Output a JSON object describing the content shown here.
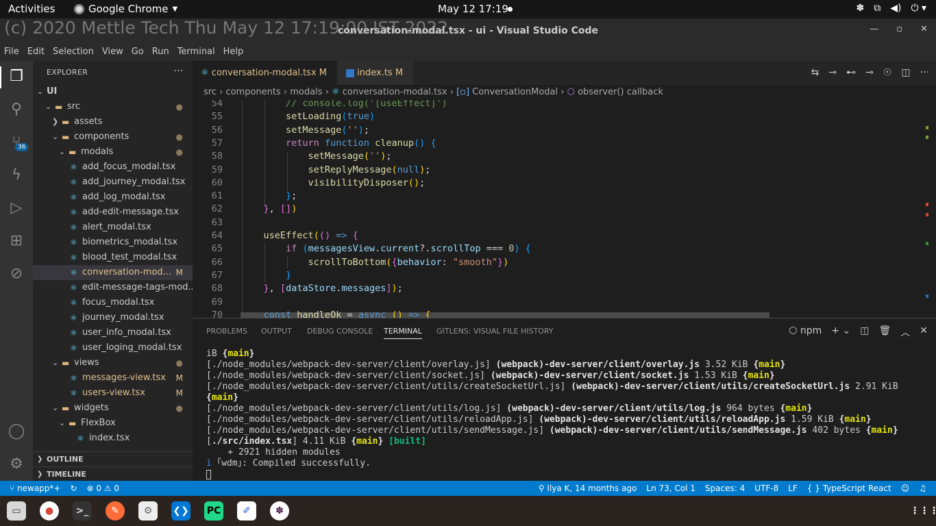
{
  "topbar": {
    "activities": "Activities",
    "app": "Google Chrome",
    "clock": "May 12  17:19"
  },
  "window": {
    "title": "conversation-modal.tsx - ui - Visual Studio Code",
    "watermark": "(c) 2020 Mettle Tech Thu May 12 17:19:00 IST 2022"
  },
  "menu": [
    "File",
    "Edit",
    "Selection",
    "View",
    "Go",
    "Run",
    "Terminal",
    "Help"
  ],
  "activity": {
    "scm_badge": "36"
  },
  "sidebar": {
    "header": "EXPLORER",
    "tree": [
      {
        "label": "UI",
        "depth": 0,
        "kind": "root",
        "open": true,
        "status": ""
      },
      {
        "label": "src",
        "depth": 1,
        "kind": "folder",
        "open": true,
        "status": "●"
      },
      {
        "label": "assets",
        "depth": 2,
        "kind": "folder",
        "open": false,
        "status": ""
      },
      {
        "label": "components",
        "depth": 2,
        "kind": "folder",
        "open": true,
        "status": "●"
      },
      {
        "label": "modals",
        "depth": 3,
        "kind": "folder",
        "open": true,
        "status": "●"
      },
      {
        "label": "add_focus_modal.tsx",
        "depth": 4,
        "kind": "file",
        "status": ""
      },
      {
        "label": "add_journey_modal.tsx",
        "depth": 4,
        "kind": "file",
        "status": ""
      },
      {
        "label": "add_log_modal.tsx",
        "depth": 4,
        "kind": "file",
        "status": ""
      },
      {
        "label": "add-edit-message.tsx",
        "depth": 4,
        "kind": "file",
        "status": ""
      },
      {
        "label": "alert_modal.tsx",
        "depth": 4,
        "kind": "file",
        "status": ""
      },
      {
        "label": "biometrics_modal.tsx",
        "depth": 4,
        "kind": "file",
        "status": ""
      },
      {
        "label": "blood_test_modal.tsx",
        "depth": 4,
        "kind": "file",
        "status": ""
      },
      {
        "label": "conversation-mod...",
        "depth": 4,
        "kind": "file",
        "status": "M",
        "selected": true
      },
      {
        "label": "edit-message-tags-mod...",
        "depth": 4,
        "kind": "file",
        "status": ""
      },
      {
        "label": "focus_modal.tsx",
        "depth": 4,
        "kind": "file",
        "status": ""
      },
      {
        "label": "journey_modal.tsx",
        "depth": 4,
        "kind": "file",
        "status": ""
      },
      {
        "label": "user_info_modal.tsx",
        "depth": 4,
        "kind": "file",
        "status": ""
      },
      {
        "label": "user_loging_modal.tsx",
        "depth": 4,
        "kind": "file",
        "status": ""
      },
      {
        "label": "views",
        "depth": 2,
        "kind": "folder",
        "open": true,
        "status": "●"
      },
      {
        "label": "messages-view.tsx",
        "depth": 4,
        "kind": "file",
        "status": "M"
      },
      {
        "label": "users-view.tsx",
        "depth": 4,
        "kind": "file",
        "status": "M"
      },
      {
        "label": "widgets",
        "depth": 2,
        "kind": "folder",
        "open": true,
        "status": "●"
      },
      {
        "label": "FlexBox",
        "depth": 3,
        "kind": "folder",
        "open": true,
        "status": ""
      },
      {
        "label": "index.tsx",
        "depth": 5,
        "kind": "file",
        "status": ""
      }
    ],
    "outline": "OUTLINE",
    "timeline": "TIMELINE"
  },
  "tabs": [
    {
      "label": "conversation-modal.tsx",
      "badge": "M",
      "active": true,
      "close": "✕"
    },
    {
      "label": "index.ts",
      "badge": "M",
      "active": false
    }
  ],
  "breadcrumb": [
    "src",
    "components",
    "modals",
    "conversation-modal.tsx",
    "ConversationModal",
    "observer() callback"
  ],
  "code": [
    {
      "n": "54",
      "t": [
        [
          "cm",
          "        // console.log('[useEffect]')"
        ]
      ]
    },
    {
      "n": "55",
      "t": [
        [
          "",
          "        "
        ],
        [
          "fn",
          "setLoading"
        ],
        [
          "p3",
          "("
        ],
        [
          "kw",
          "true"
        ],
        [
          "p3",
          ")"
        ]
      ]
    },
    {
      "n": "56",
      "t": [
        [
          "",
          "        "
        ],
        [
          "fn",
          "setMessage"
        ],
        [
          "p3",
          "("
        ],
        [
          "st",
          "''"
        ],
        [
          "p3",
          ")"
        ],
        [
          "",
          ";"
        ]
      ]
    },
    {
      "n": "57",
      "t": [
        [
          "",
          "        "
        ],
        [
          "ctl",
          "return"
        ],
        [
          "",
          " "
        ],
        [
          "kw",
          "function"
        ],
        [
          "",
          " "
        ],
        [
          "fn",
          "cleanup"
        ],
        [
          "p3",
          "()"
        ],
        [
          "",
          " "
        ],
        [
          "p3",
          "{"
        ]
      ]
    },
    {
      "n": "58",
      "t": [
        [
          "",
          "            "
        ],
        [
          "fn",
          "setMessage"
        ],
        [
          "p1",
          "("
        ],
        [
          "st",
          "''"
        ],
        [
          "p1",
          ")"
        ],
        [
          "",
          ";"
        ]
      ]
    },
    {
      "n": "59",
      "t": [
        [
          "",
          "            "
        ],
        [
          "fn",
          "setReplyMessage"
        ],
        [
          "p1",
          "("
        ],
        [
          "kw",
          "null"
        ],
        [
          "p1",
          ")"
        ],
        [
          "",
          ";"
        ]
      ]
    },
    {
      "n": "60",
      "t": [
        [
          "",
          "            "
        ],
        [
          "fn",
          "visibilityDisposer"
        ],
        [
          "p1",
          "()"
        ],
        [
          "",
          ";"
        ]
      ]
    },
    {
      "n": "61",
      "t": [
        [
          "",
          "        "
        ],
        [
          "p3",
          "}"
        ],
        [
          "",
          ";"
        ]
      ]
    },
    {
      "n": "62",
      "t": [
        [
          "",
          "    "
        ],
        [
          "p2",
          "}"
        ],
        [
          "",
          ", "
        ],
        [
          "p2",
          "[]"
        ],
        [
          "p1",
          ")"
        ]
      ]
    },
    {
      "n": "63",
      "t": [
        [
          "",
          ""
        ]
      ]
    },
    {
      "n": "64",
      "t": [
        [
          "",
          "    "
        ],
        [
          "fn",
          "useEffect"
        ],
        [
          "p1",
          "("
        ],
        [
          "p2",
          "()"
        ],
        [
          "",
          " "
        ],
        [
          "kw",
          "=>"
        ],
        [
          "",
          " "
        ],
        [
          "p2",
          "{"
        ]
      ]
    },
    {
      "n": "65",
      "t": [
        [
          "",
          "        "
        ],
        [
          "ctl",
          "if"
        ],
        [
          "",
          " "
        ],
        [
          "p3",
          "("
        ],
        [
          "vr",
          "messagesView"
        ],
        [
          "",
          "."
        ],
        [
          "vr",
          "current"
        ],
        [
          "",
          "?."
        ],
        [
          "vr",
          "scrollTop"
        ],
        [
          "",
          " === "
        ],
        [
          "nm",
          "0"
        ],
        [
          "p3",
          ")"
        ],
        [
          "",
          " "
        ],
        [
          "p3",
          "{"
        ]
      ]
    },
    {
      "n": "66",
      "t": [
        [
          "",
          "            "
        ],
        [
          "fn",
          "scrollToBottom"
        ],
        [
          "p1",
          "("
        ],
        [
          "p2",
          "{"
        ],
        [
          "vr",
          "behavior"
        ],
        [
          "",
          ": "
        ],
        [
          "st",
          "\"smooth\""
        ],
        [
          "p2",
          "}"
        ],
        [
          "p1",
          ")"
        ]
      ]
    },
    {
      "n": "67",
      "t": [
        [
          "",
          "        "
        ],
        [
          "p3",
          "}"
        ]
      ]
    },
    {
      "n": "68",
      "t": [
        [
          "",
          "    "
        ],
        [
          "p2",
          "}"
        ],
        [
          "",
          ", "
        ],
        [
          "p2",
          "["
        ],
        [
          "vr",
          "dataStore"
        ],
        [
          "",
          "."
        ],
        [
          "vr",
          "messages"
        ],
        [
          "p2",
          "]"
        ],
        [
          "p1",
          ")"
        ],
        [
          "",
          ";"
        ]
      ]
    },
    {
      "n": "69",
      "t": [
        [
          "",
          ""
        ]
      ]
    },
    {
      "n": "70",
      "t": [
        [
          "",
          "    "
        ],
        [
          "kw",
          "const"
        ],
        [
          "",
          " "
        ],
        [
          "fn",
          "handleOk"
        ],
        [
          "",
          " = "
        ],
        [
          "kw",
          "async"
        ],
        [
          "",
          " "
        ],
        [
          "p1",
          "()"
        ],
        [
          "",
          " "
        ],
        [
          "kw",
          "=>"
        ],
        [
          "",
          " "
        ],
        [
          "p1",
          "{"
        ]
      ]
    }
  ],
  "panel": {
    "tabs": [
      "PROBLEMS",
      "OUTPUT",
      "DEBUG CONSOLE",
      "TERMINAL",
      "GITLENS: VISUAL FILE HISTORY"
    ],
    "active_tab": "TERMINAL",
    "task": "npm",
    "lines": [
      [
        [
          "",
          "iB "
        ],
        [
          "b",
          "{"
        ],
        [
          "y",
          "main"
        ],
        [
          "b",
          "}"
        ]
      ],
      [
        [
          "",
          "[./node_modules/webpack-dev-server/client/overlay.js] "
        ],
        [
          "b",
          "(webpack)-dev-server/client/overlay.js"
        ],
        [
          "",
          " 3.52 KiB "
        ],
        [
          "b",
          "{"
        ],
        [
          "y",
          "main"
        ],
        [
          "b",
          "}"
        ]
      ],
      [
        [
          "",
          "[./node_modules/webpack-dev-server/client/socket.js] "
        ],
        [
          "b",
          "(webpack)-dev-server/client/socket.js"
        ],
        [
          "",
          " 1.53 KiB "
        ],
        [
          "b",
          "{"
        ],
        [
          "y",
          "main"
        ],
        [
          "b",
          "}"
        ]
      ],
      [
        [
          "",
          "[./node_modules/webpack-dev-server/client/utils/createSocketUrl.js] "
        ],
        [
          "b",
          "(webpack)-dev-server/client/utils/createSocketUrl.js"
        ],
        [
          "",
          " 2.91 KiB"
        ]
      ],
      [
        [
          "b",
          "{"
        ],
        [
          "y",
          "main"
        ],
        [
          "b",
          "}"
        ]
      ],
      [
        [
          "",
          "[./node_modules/webpack-dev-server/client/utils/log.js] "
        ],
        [
          "b",
          "(webpack)-dev-server/client/utils/log.js"
        ],
        [
          "",
          " 964 bytes "
        ],
        [
          "b",
          "{"
        ],
        [
          "y",
          "main"
        ],
        [
          "b",
          "}"
        ]
      ],
      [
        [
          "",
          "[./node_modules/webpack-dev-server/client/utils/reloadApp.js] "
        ],
        [
          "b",
          "(webpack)-dev-server/client/utils/reloadApp.js"
        ],
        [
          "",
          " 1.59 KiB "
        ],
        [
          "b",
          "{"
        ],
        [
          "y",
          "main"
        ],
        [
          "b",
          "}"
        ]
      ],
      [
        [
          "",
          "[./node_modules/webpack-dev-server/client/utils/sendMessage.js] "
        ],
        [
          "b",
          "(webpack)-dev-server/client/utils/sendMessage.js"
        ],
        [
          "",
          " 402 bytes "
        ],
        [
          "b",
          "{"
        ],
        [
          "y",
          "main"
        ],
        [
          "b",
          "}"
        ]
      ],
      [
        [
          "",
          "["
        ],
        [
          "b",
          "./src/index.tsx"
        ],
        [
          "",
          "] 4.11 KiB "
        ],
        [
          "b",
          "{"
        ],
        [
          "y",
          "main"
        ],
        [
          "b",
          "}"
        ],
        [
          "",
          " "
        ],
        [
          "g",
          "[built]"
        ]
      ],
      [
        [
          "",
          "    + 2921 hidden modules"
        ]
      ],
      [
        [
          "bl",
          "i"
        ],
        [
          "",
          " ｢wdm｣: Compiled successfully."
        ]
      ]
    ]
  },
  "status": {
    "branch": "newapp*+",
    "errors": "⊗ 0 ⚠ 0",
    "blame": "Ilya K, 14 months ago",
    "position": "Ln 73, Col 1",
    "spaces": "Spaces: 4",
    "encoding": "UTF-8",
    "eol": "LF",
    "language": "{ } TypeScript React"
  },
  "colors": {
    "accent": "#007acc",
    "modified": "#e2c08d",
    "react": "#61dafb"
  }
}
